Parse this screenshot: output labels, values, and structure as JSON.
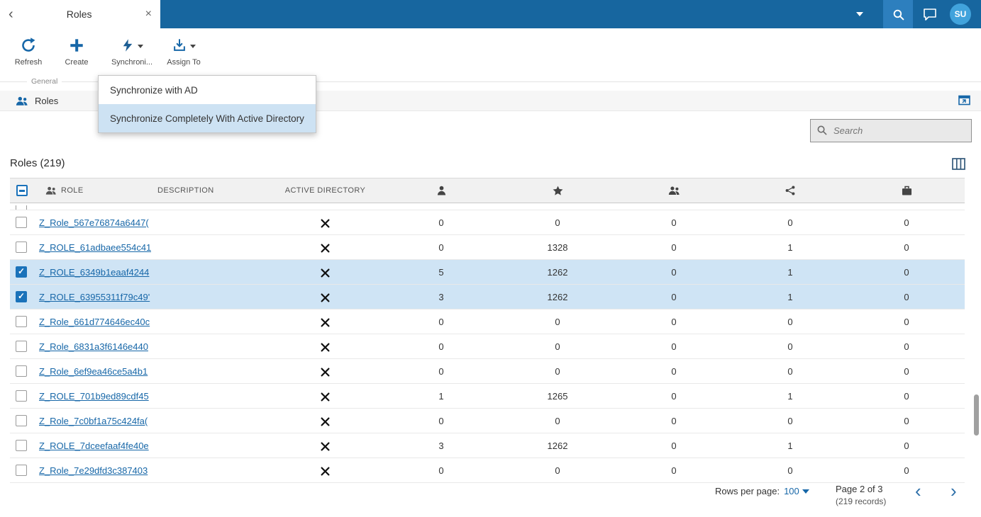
{
  "topbar": {
    "tab_title": "Roles",
    "avatar": "SU"
  },
  "icons": {
    "back_chevron": "‹",
    "tab_close": "×",
    "prev_page": "‹",
    "next_page": "›"
  },
  "toolbar": {
    "group_label": "General",
    "buttons": [
      {
        "label": "Refresh",
        "icon": "refresh-icon"
      },
      {
        "label": "Create",
        "icon": "plus-icon"
      },
      {
        "label": "Synchroni...",
        "icon": "lightning-icon",
        "caret": true
      },
      {
        "label": "Assign To",
        "icon": "assign-download-icon",
        "caret": true
      }
    ]
  },
  "menu": {
    "items": [
      {
        "label": "Synchronize with AD",
        "highlighted": false
      },
      {
        "label": "Synchronize Completely With Active Directory",
        "highlighted": true
      }
    ]
  },
  "breadcrumb": {
    "label": "Roles"
  },
  "search": {
    "placeholder": "Search"
  },
  "grid": {
    "title": "Roles (219)",
    "header": {
      "role": "ROLE",
      "description": "DESCRIPTION",
      "active_directory": "ACTIVE DIRECTORY",
      "icon_columns": [
        "person-icon",
        "star-icon",
        "people-icon",
        "share-icon",
        "briefcase-icon"
      ]
    },
    "rows": [
      {
        "name": "Z_Role_567e76874a6447(",
        "description": "",
        "selected": false,
        "ad": "x-mark",
        "values": [
          "0",
          "0",
          "0",
          "0",
          "0"
        ]
      },
      {
        "name": "Z_ROLE_61adbaee554c41",
        "description": "",
        "selected": false,
        "ad": "x-mark",
        "values": [
          "0",
          "1328",
          "0",
          "1",
          "0"
        ]
      },
      {
        "name": "Z_ROLE_6349b1eaaf4244",
        "description": "",
        "selected": true,
        "ad": "x-mark",
        "values": [
          "5",
          "1262",
          "0",
          "1",
          "0"
        ]
      },
      {
        "name": "Z_ROLE_63955311f79c49'",
        "description": "",
        "selected": true,
        "ad": "x-mark",
        "values": [
          "3",
          "1262",
          "0",
          "1",
          "0"
        ]
      },
      {
        "name": "Z_Role_661d774646ec40c",
        "description": "",
        "selected": false,
        "ad": "x-mark",
        "values": [
          "0",
          "0",
          "0",
          "0",
          "0"
        ]
      },
      {
        "name": "Z_Role_6831a3f6146e440",
        "description": "",
        "selected": false,
        "ad": "x-mark",
        "values": [
          "0",
          "0",
          "0",
          "0",
          "0"
        ]
      },
      {
        "name": "Z_Role_6ef9ea46ce5a4b1",
        "description": "",
        "selected": false,
        "ad": "x-mark",
        "values": [
          "0",
          "0",
          "0",
          "0",
          "0"
        ]
      },
      {
        "name": "Z_ROLE_701b9ed89cdf45",
        "description": "",
        "selected": false,
        "ad": "x-mark",
        "values": [
          "1",
          "1265",
          "0",
          "1",
          "0"
        ]
      },
      {
        "name": "Z_Role_7c0bf1a75c424fa(",
        "description": "",
        "selected": false,
        "ad": "x-mark",
        "values": [
          "0",
          "0",
          "0",
          "0",
          "0"
        ]
      },
      {
        "name": "Z_ROLE_7dceefaaf4fe40e",
        "description": "",
        "selected": false,
        "ad": "x-mark",
        "values": [
          "3",
          "1262",
          "0",
          "1",
          "0"
        ]
      },
      {
        "name": "Z_Role_7e29dfd3c387403",
        "description": "",
        "selected": false,
        "ad": "x-mark",
        "values": [
          "0",
          "0",
          "0",
          "0",
          "0"
        ]
      }
    ]
  },
  "footer": {
    "rows_per_page_label": "Rows per page:",
    "rows_per_page_value": "100",
    "page_label": "Page 2 of 3",
    "records_label": "(219 records)"
  },
  "colors": {
    "topbar": "#17669F",
    "accent": "#1767A8",
    "selected_row": "#CFE4F5",
    "menu_highlight": "#CDE2F3"
  }
}
